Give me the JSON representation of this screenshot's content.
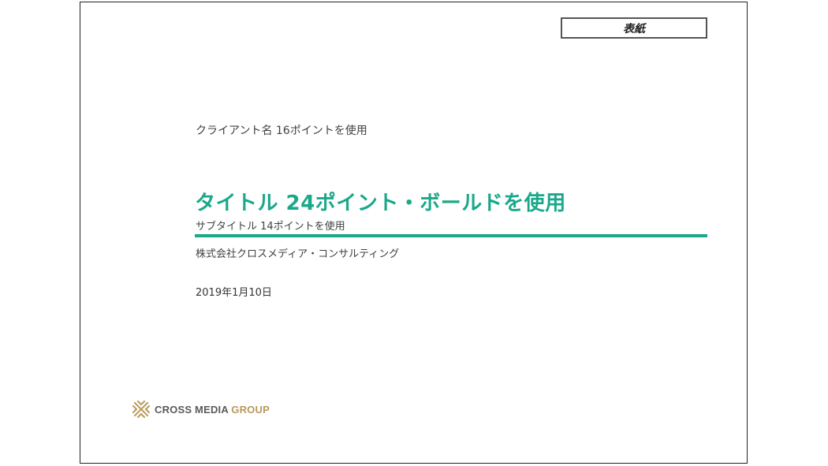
{
  "slide": {
    "tag": "表紙",
    "client_name": "クライアント名 16ポイントを使用",
    "title": "タイトル 24ポイント・ボールドを使用",
    "subtitle": "サブタイトル 14ポイントを使用",
    "company": "株式会社クロスメディア・コンサルティング",
    "date": "2019年1月10日",
    "logo_text_a": "CROSS MEDIA ",
    "logo_text_b": "GROUP"
  },
  "colors": {
    "accent": "#1aa88a",
    "logo_gold": "#b89a5a",
    "logo_gray": "#5a5a5a",
    "text": "#404040"
  },
  "icons": {
    "logo": "cross-media-logo-icon"
  }
}
